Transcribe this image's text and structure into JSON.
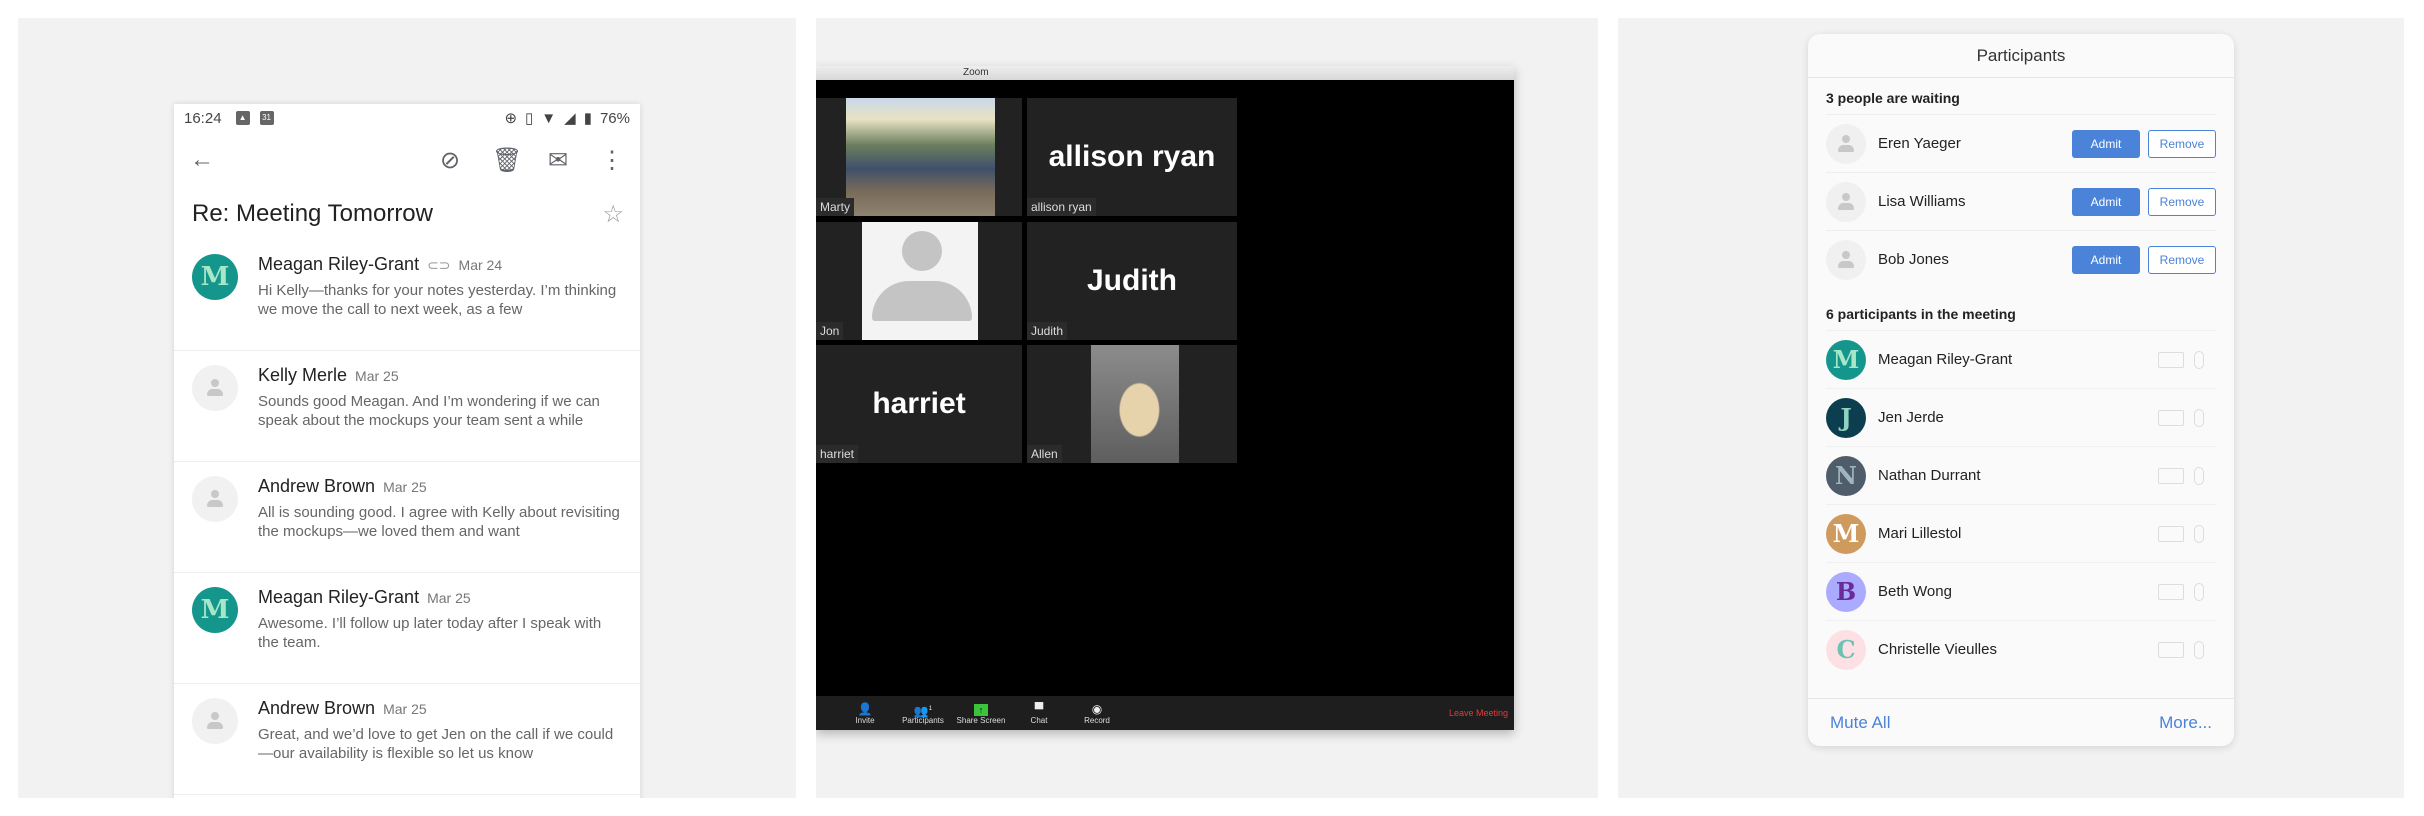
{
  "gmail": {
    "status_bar": {
      "time": "16:24",
      "left_icons": [
        "image-icon",
        "calendar-icon"
      ],
      "calendar_day": "31",
      "right_icons": [
        "data-saver-icon",
        "vibrate-icon",
        "wifi-icon",
        "signal-icon",
        "battery-icon"
      ],
      "battery": "76%"
    },
    "app_bar": {
      "back_icon": "←",
      "actions": [
        "label-off-icon",
        "delete-icon",
        "mark-unread-icon",
        "more-vert-icon"
      ]
    },
    "subject": "Re: Meeting Tomorrow",
    "star_icon": "☆",
    "messages": [
      {
        "sender": "Meagan Riley-Grant",
        "avatar": "M",
        "has_attachment": true,
        "date": "Mar 24",
        "snippet": "Hi Kelly—thanks for your notes yesterday. I’m thinking we move the call to next week, as a few"
      },
      {
        "sender": "Kelly Merle",
        "avatar": "",
        "has_attachment": false,
        "date": "Mar 25",
        "snippet": "Sounds good Meagan. And I’m wondering if we can speak about the mockups your team sent a while"
      },
      {
        "sender": "Andrew Brown",
        "avatar": "",
        "has_attachment": false,
        "date": "Mar 25",
        "snippet": "All is sounding good. I agree with Kelly about revisiting the mockups—we loved them and want"
      },
      {
        "sender": "Meagan Riley-Grant",
        "avatar": "M",
        "has_attachment": false,
        "date": "Mar 25",
        "snippet": "Awesome. I’ll follow up later today after I speak with the team."
      },
      {
        "sender": "Andrew Brown",
        "avatar": "",
        "has_attachment": false,
        "date": "Mar 25",
        "snippet": "Great, and we’d love to get Jen on the call if we could—our availability is flexible so let us know"
      }
    ]
  },
  "zoom": {
    "window_title": "Zoom",
    "tiles": [
      {
        "name": "Marty",
        "display": "",
        "type": "photo-guitar"
      },
      {
        "name": "allison ryan",
        "display": "allison ryan",
        "type": "name"
      },
      {
        "name": "Jon",
        "display": "",
        "type": "placeholder"
      },
      {
        "name": "Judith",
        "display": "Judith",
        "type": "name"
      },
      {
        "name": "harriet",
        "display": "harriet",
        "type": "name"
      },
      {
        "name": "Allen",
        "display": "",
        "type": "photo-dog"
      }
    ],
    "toolbar": {
      "buttons": [
        {
          "label": "Invite",
          "icon": "invite-icon"
        },
        {
          "label": "Participants",
          "icon": "participants-icon",
          "badge": "1"
        },
        {
          "label": "Share Screen",
          "icon": "share-screen-icon"
        },
        {
          "label": "Chat",
          "icon": "chat-icon"
        },
        {
          "label": "Record",
          "icon": "record-icon"
        }
      ],
      "leave_label": "Leave Meeting",
      "share_color": "#3bc43b",
      "leave_color": "#e23b3b"
    }
  },
  "participants": {
    "title": "Participants",
    "waiting_title": "3 people are waiting",
    "waiting": [
      {
        "name": "Eren Yaeger"
      },
      {
        "name": "Lisa Williams"
      },
      {
        "name": "Bob Jones"
      }
    ],
    "admit_label": "Admit",
    "remove_label": "Remove",
    "meeting_title": "6 participants in the meeting",
    "meeting": [
      {
        "name": "Meagan Riley-Grant",
        "initial": "M",
        "bg": "#15968c",
        "fg": "#a8e6c8"
      },
      {
        "name": "Jen Jerde",
        "initial": "J",
        "bg": "#0c3e4f",
        "fg": "#8fd3c0"
      },
      {
        "name": "Nathan Durrant",
        "initial": "N",
        "bg": "#4f5d6b",
        "fg": "#9fb6bf"
      },
      {
        "name": "Mari Lillestol",
        "initial": "M",
        "bg": "#cf9a5e",
        "fg": "#ffffff"
      },
      {
        "name": "Beth Wong",
        "initial": "B",
        "bg": "#aaaaff",
        "fg": "#6a2a9a"
      },
      {
        "name": "Christelle Vieulles",
        "initial": "C",
        "bg": "#fde0e4",
        "fg": "#6cc2b4"
      }
    ],
    "mute_all_label": "Mute All",
    "more_label": "More...",
    "accent": "#4a83d8"
  }
}
